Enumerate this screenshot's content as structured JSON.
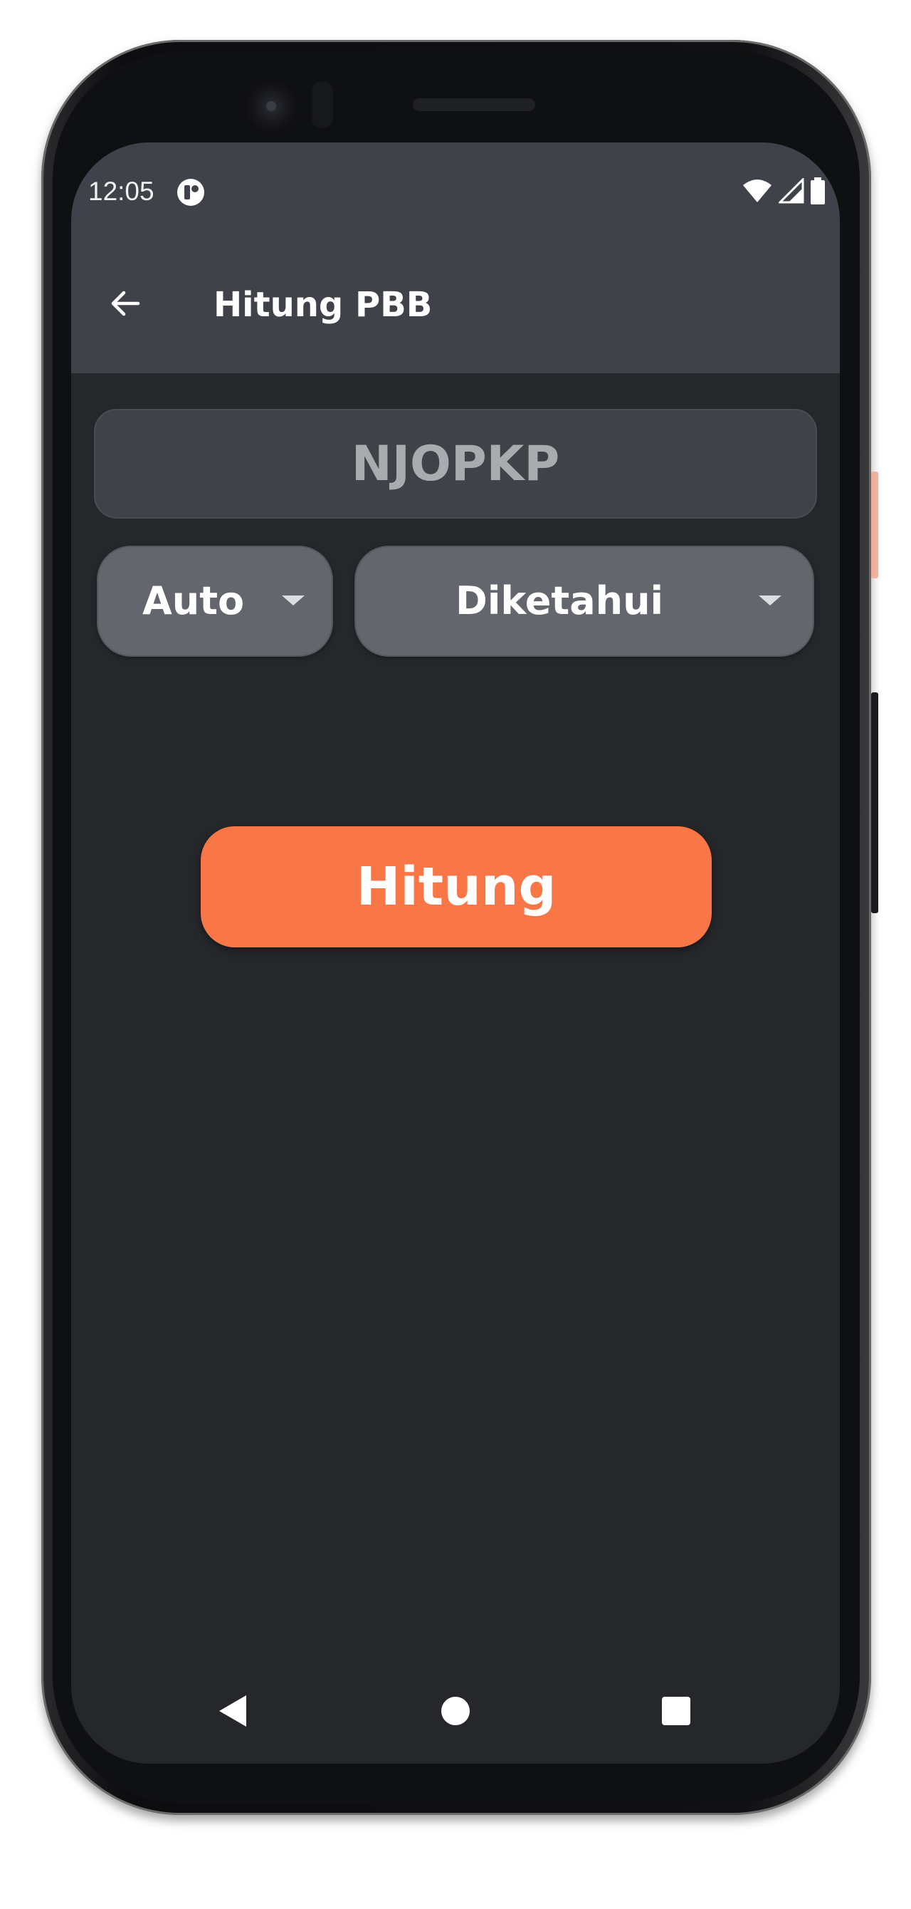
{
  "status_bar": {
    "time": "12:05",
    "icons": [
      "app-notification-icon",
      "wifi-icon",
      "signal-icon",
      "battery-icon"
    ]
  },
  "app_bar": {
    "title": "Hitung PBB",
    "back_icon": "arrow-left-icon"
  },
  "form": {
    "njopkp": {
      "placeholder": "NJOPKP",
      "value": ""
    },
    "mode_dropdown": {
      "selected": "Auto"
    },
    "status_dropdown": {
      "selected": "Diketahui"
    },
    "submit_label": "Hitung"
  },
  "nav_bar": {
    "icons": [
      "nav-back-icon",
      "nav-home-icon",
      "nav-recents-icon"
    ]
  },
  "colors": {
    "accent": "#f97646",
    "background": "#25272b",
    "appbar": "#404249",
    "dropdown": "#63666d",
    "input": "#3f4248"
  }
}
